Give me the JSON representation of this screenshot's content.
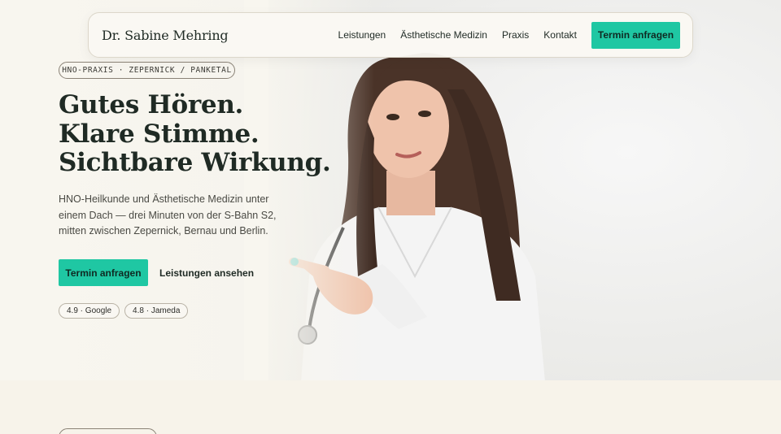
{
  "nav": {
    "brand": "Dr. Sabine Mehring",
    "links": [
      "Leistungen",
      "Ästhetische Medizin",
      "Praxis",
      "Kontakt"
    ],
    "cta": "Termin anfragen"
  },
  "hero": {
    "eyebrow": "HNO-PRAXIS · ZEPERNICK / PANKETAL",
    "headline": [
      "Gutes Hören.",
      "Klare Stimme.",
      "Sichtbare Wirkung."
    ],
    "lead": "HNO-Heilkunde und Ästhetische Medizin unter einem Dach — drei Minuten von der S-Bahn S2, mitten zwischen Zepernick, Bernau und Berlin.",
    "primary_cta": "Termin anfragen",
    "secondary_cta": "Leistungen ansehen",
    "ratings": [
      "4.9 · Google",
      "4.8 · Jameda"
    ]
  },
  "colors": {
    "accent": "#1fc7a3",
    "background": "#f7f3ea",
    "text": "#1f2a24"
  }
}
